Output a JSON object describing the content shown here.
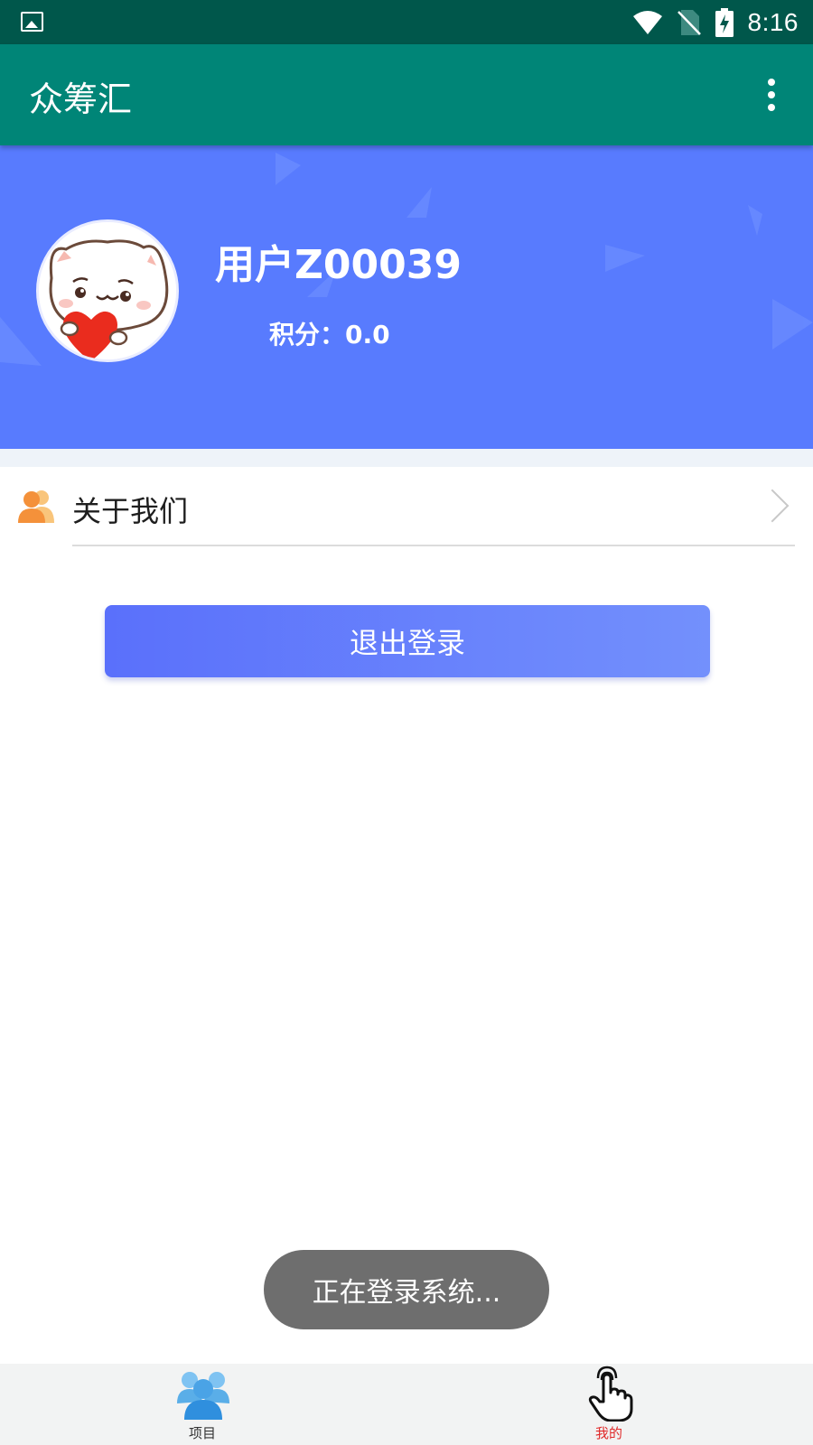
{
  "status_bar": {
    "time": "8:16",
    "icons": [
      "gallery-icon",
      "wifi-icon",
      "no-sim-icon",
      "battery-charging-icon"
    ]
  },
  "app_bar": {
    "title": "众筹汇",
    "menu_icon": "overflow-menu-icon"
  },
  "profile": {
    "username": "用户Z00039",
    "points": "积分：0.0",
    "avatar": "cat-with-heart-avatar"
  },
  "menu": {
    "items": [
      {
        "label": "关于我们",
        "icon": "people-icon",
        "chevron": "chevron-right-icon"
      }
    ]
  },
  "logout": {
    "label": "退出登录"
  },
  "toast": {
    "message": "正在登录系统..."
  },
  "bottom_nav": {
    "items": [
      {
        "label": "项目",
        "icon": "group-people-icon",
        "active": false
      },
      {
        "label": "我的",
        "icon": "hand-pointer-icon",
        "active": true
      }
    ]
  },
  "colors": {
    "status_bar": "#00574b",
    "app_bar": "#008577",
    "profile_header": "#587bfe",
    "active_tab": "#e02a2a"
  }
}
